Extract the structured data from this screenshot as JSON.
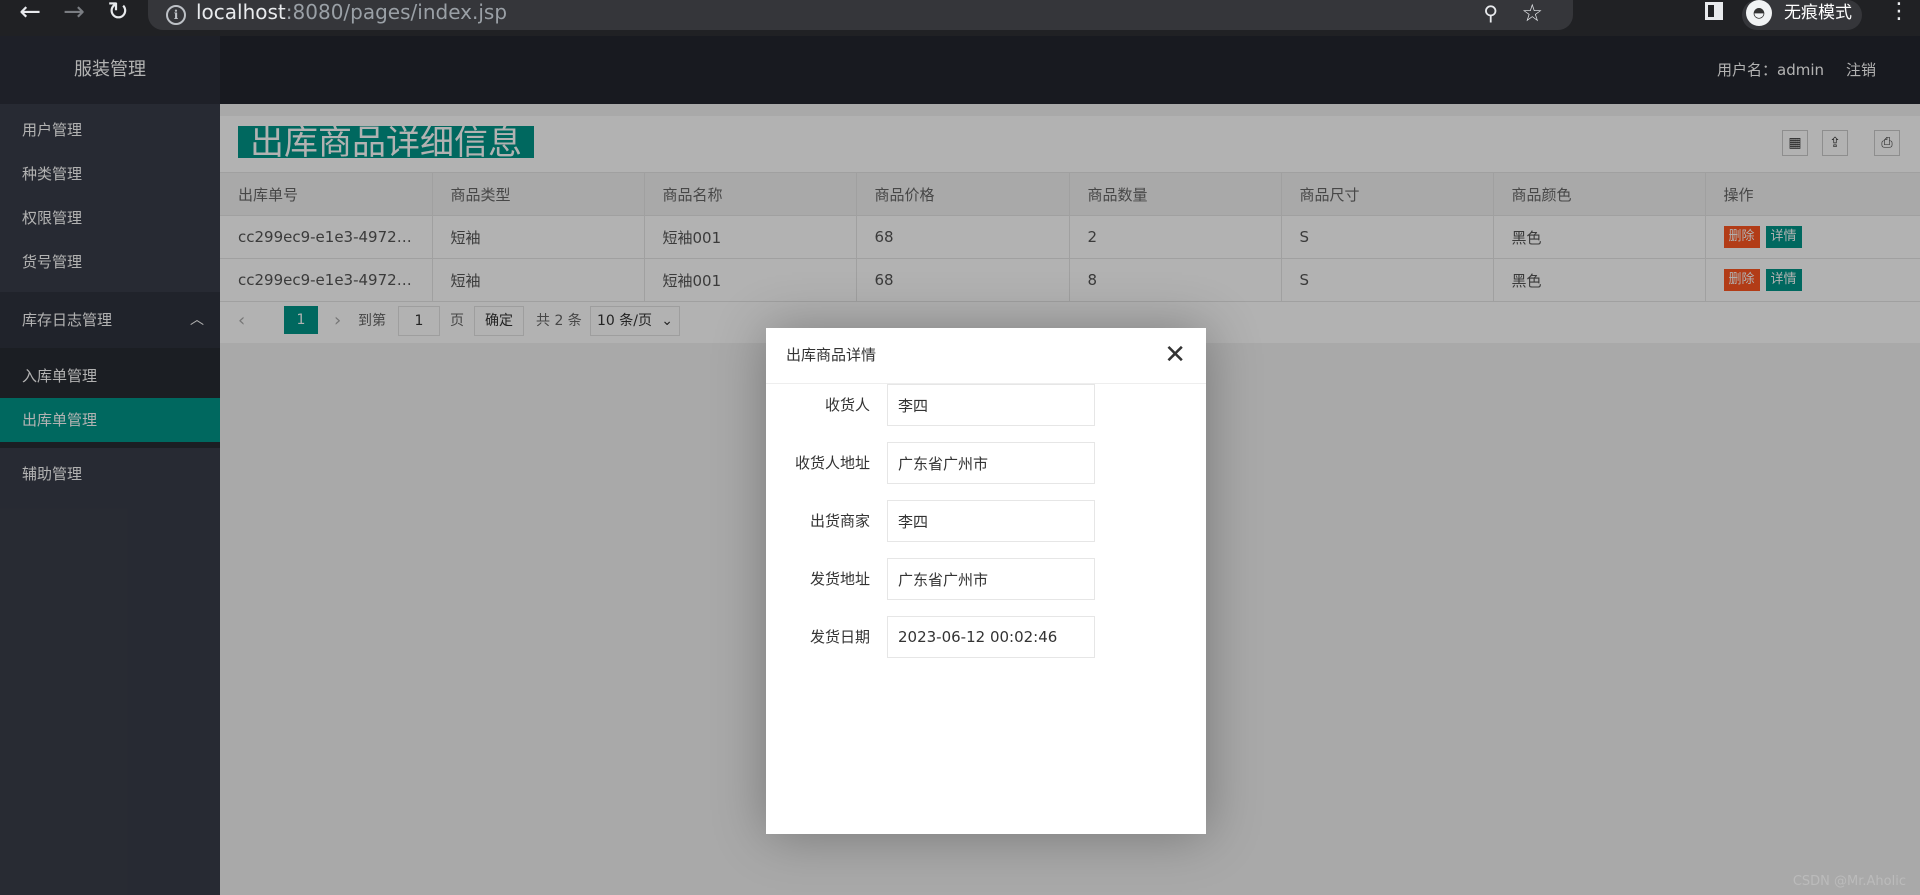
{
  "browser": {
    "url_host": "localhost",
    "url_rest": ":8080/pages/index.jsp",
    "incognito_label": "无痕模式"
  },
  "sidebar": {
    "brand": "服装管理",
    "items": [
      {
        "label": "用户管理"
      },
      {
        "label": "种类管理"
      },
      {
        "label": "权限管理"
      },
      {
        "label": "货号管理"
      }
    ],
    "group": {
      "label": "库存日志管理",
      "children": [
        {
          "label": "入库单管理"
        },
        {
          "label": "出库单管理"
        }
      ]
    },
    "extra": {
      "label": "辅助管理"
    }
  },
  "header": {
    "user_label": "用户名：admin",
    "logout_label": "注销"
  },
  "main": {
    "title": "出库商品详细信息",
    "columns": [
      "出库单号",
      "商品类型",
      "商品名称",
      "商品价格",
      "商品数量",
      "商品尺寸",
      "商品颜色",
      "操作"
    ],
    "rows": [
      {
        "id": "cc299ec9-e1e3-4972-b...",
        "type": "短袖",
        "name": "短袖001",
        "price": "68",
        "qty": "2",
        "size": "S",
        "color": "黑色"
      },
      {
        "id": "cc299ec9-e1e3-4972-b...",
        "type": "短袖",
        "name": "短袖001",
        "price": "68",
        "qty": "8",
        "size": "S",
        "color": "黑色"
      }
    ],
    "actions": {
      "delete": "删除",
      "detail": "详情"
    },
    "pager": {
      "current": "1",
      "goto_prefix": "到第",
      "goto_value": "1",
      "goto_suffix": "页",
      "confirm": "确定",
      "total": "共 2 条",
      "page_size": "10 条/页"
    }
  },
  "modal": {
    "title": "出库商品详情",
    "fields": [
      {
        "label": "收货人",
        "value": "李四"
      },
      {
        "label": "收货人地址",
        "value": "广东省广州市"
      },
      {
        "label": "出货商家",
        "value": "李四"
      },
      {
        "label": "发货地址",
        "value": "广东省广州市"
      },
      {
        "label": "发货日期",
        "value": "2023-06-12 00:02:46"
      }
    ]
  },
  "watermark": "CSDN @Mr.Aholic",
  "colors": {
    "accent": "#009688",
    "danger": "#ff5722",
    "sidebar": "#393d49",
    "header": "#23262e"
  }
}
